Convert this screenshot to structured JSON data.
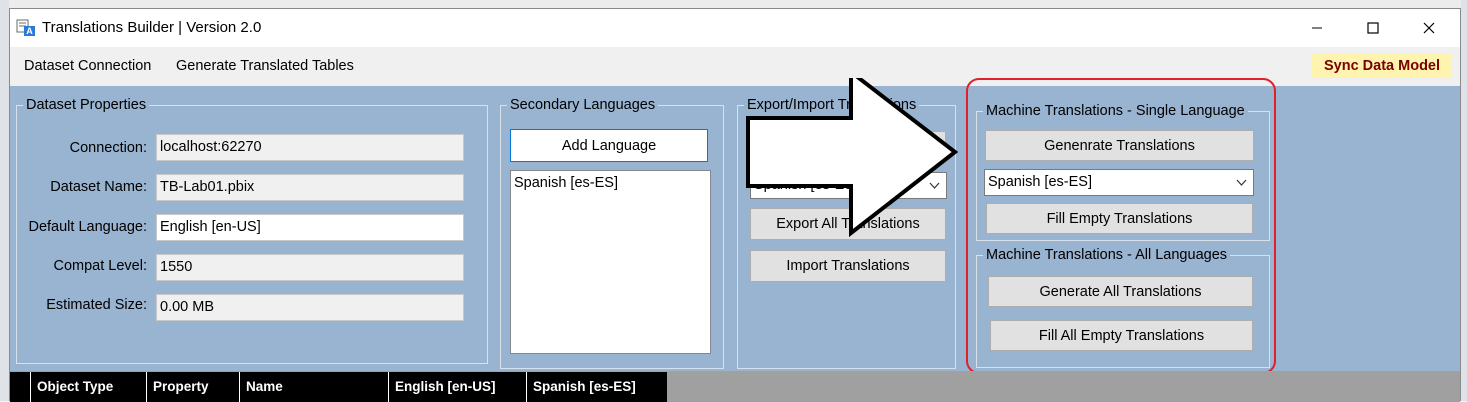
{
  "window": {
    "title": "Translations Builder | Version 2.0"
  },
  "menu": {
    "dataset_connection": "Dataset Connection",
    "generate_translated_tables": "Generate Translated Tables",
    "sync_data_model": "Sync Data Model"
  },
  "dataset_properties": {
    "legend": "Dataset Properties",
    "connection_label": "Connection:",
    "connection_value": "localhost:62270",
    "dataset_name_label": "Dataset Name:",
    "dataset_name_value": "TB-Lab01.pbix",
    "default_language_label": "Default Language:",
    "default_language_value": "English [en-US]",
    "compat_level_label": "Compat Level:",
    "compat_level_value": "1550",
    "estimated_size_label": "Estimated Size:",
    "estimated_size_value": "0.00 MB"
  },
  "secondary_languages": {
    "legend": "Secondary Languages",
    "add_language": "Add Language",
    "items": [
      "Spanish [es-ES]"
    ]
  },
  "export_import": {
    "legend": "Export/Import Translations",
    "combo_value": "Spanish [es-ES]",
    "export_all": "Export All Translations",
    "import": "Import Translations"
  },
  "machine_single": {
    "legend": "Machine Translations - Single Language",
    "generate": "Genenrate Translations",
    "language_value": "Spanish [es-ES]",
    "fill_empty": "Fill Empty Translations"
  },
  "machine_all": {
    "legend": "Machine Translations - All Languages",
    "generate_all": "Generate All Translations",
    "fill_all_empty": "Fill All Empty Translations"
  },
  "grid": {
    "columns": [
      "Object Type",
      "Property",
      "Name",
      "English [en-US]",
      "Spanish [es-ES]"
    ]
  },
  "colors": {
    "panel": "#99b4d1",
    "highlight": "#e0202a",
    "sync_bg": "#fff3b0"
  },
  "icons": {
    "app": "translation-app-icon",
    "minimize": "minimize-icon",
    "maximize": "maximize-icon",
    "close": "close-icon",
    "dropdown": "chevron-down-icon",
    "overlay": "right-arrow-icon"
  }
}
